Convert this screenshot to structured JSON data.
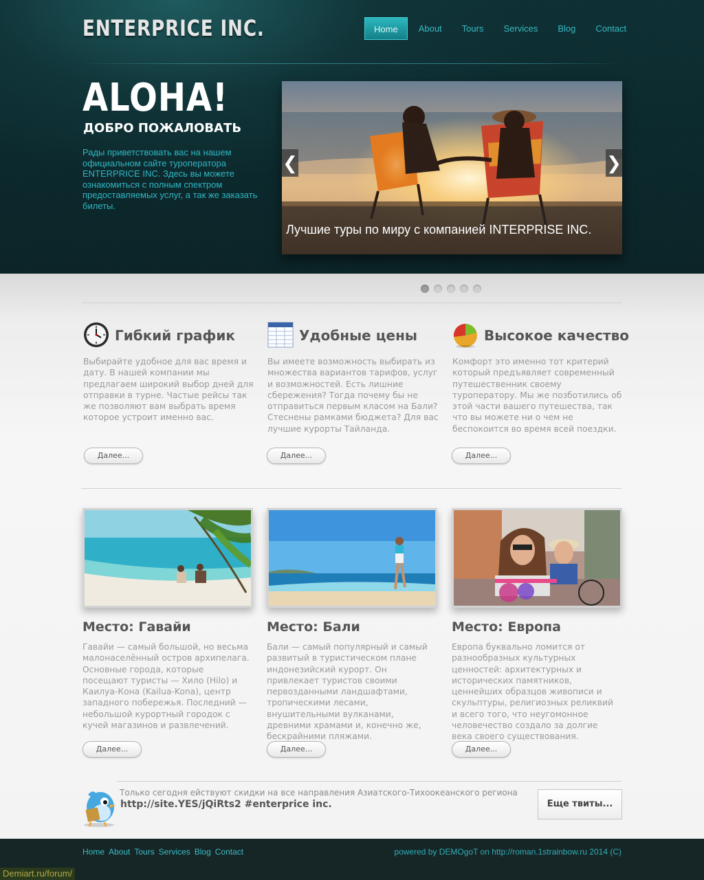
{
  "header": {
    "logo": "ENTERPRICE INC.",
    "nav": [
      "Home",
      "About",
      "Tours",
      "Services",
      "Blog",
      "Contact"
    ],
    "active_nav": "Home"
  },
  "hero": {
    "title": "ALOHA!",
    "subtitle": "ДОБРО ПОЖАЛОВАТЬ",
    "text": "Рады приветствовать вас на нашем официальном сайте туроператора ENTERPRICE INC. Здесь вы можете ознакомиться с полным спектром предоставляемых услуг, а так же заказать билеты."
  },
  "slider": {
    "caption": "Лучшие туры по миру с компанией INTERPRISE INC.",
    "prev_icon": "❮",
    "next_icon": "❯",
    "slide_count": 5,
    "active_slide": 1
  },
  "features": [
    {
      "icon": "clock-icon",
      "title": "Гибкий график",
      "text": "Выбирайте удобное для вас время и дату. В нашей компании мы предлагаем широкий выбор дней для отправки в турне. Частые рейсы так же позволяют вам выбрать время которое устроит именно вас.",
      "button": "Далее..."
    },
    {
      "icon": "table-icon",
      "title": "Удобные цены",
      "text": "Вы имеете возможность выбирать из множества вариантов тарифов, услуг и возможностей. Есть лишние сбережения? Тогда почему бы не отправиться первым класом на Бали? Стеснены рамками бюджета? Для вас лучшие курорты Тайланда.",
      "button": "Далее..."
    },
    {
      "icon": "pie-chart-icon",
      "title": "Высокое качество",
      "text": "Комфорт это именно тот критерий который предъявляет современный путешественник своему туроператору. Мы же позботились об этой части вашего путешества, так что вы можете ни о чем не беспокоится во время всей поездки.",
      "button": "Далее..."
    }
  ],
  "places": [
    {
      "title": "Место: Гавайи",
      "text": "Гавайи — самый большой, но весьма малонаселённый остров архипелага. Основные города, которые посещают туристы — Хило (Hilo) и Каилуа-Кона (Kailua-Kona), центр западного побережья. Последний — небольшой курортный городок с кучей магазинов и развлечений.",
      "button": "Далее..."
    },
    {
      "title": "Место: Бали",
      "text": "Бали — самый популярный и самый развитый в туристическом плане индонезийский курорт. Он привлекает туристов своими первозданными ландшафтами, тропическими лесами, внушительными вулканами, древними храмами и, конечно же, бескрайними пляжами.",
      "button": "Далее..."
    },
    {
      "title": "Место: Европа",
      "text": "Европа буквально ломится от разнообразных культурных ценностей: архитектурных и исторических памятников, ценнейших образцов живописи и скульптуры, религиозных реликвий и всего того, что неугомонное человечество создало за долгие века своего существования.",
      "button": "Далее..."
    }
  ],
  "twitter": {
    "icon": "twitter-bird-icon",
    "text": "Только сегодня ействуют скидки на все направления Азиатского-Тихоокеанского региона",
    "link": "http://site.YES/jQiRts2  #enterprice inc.",
    "more_button": "Еще твиты..."
  },
  "footer": {
    "nav": [
      "Home",
      "About",
      "Tours",
      "Services",
      "Blog",
      "Contact"
    ],
    "powered": "powered by DEMOgoT on http://roman.1strainbow.ru 2014 (C)",
    "watermark": "Demiart.ru/forum/"
  }
}
